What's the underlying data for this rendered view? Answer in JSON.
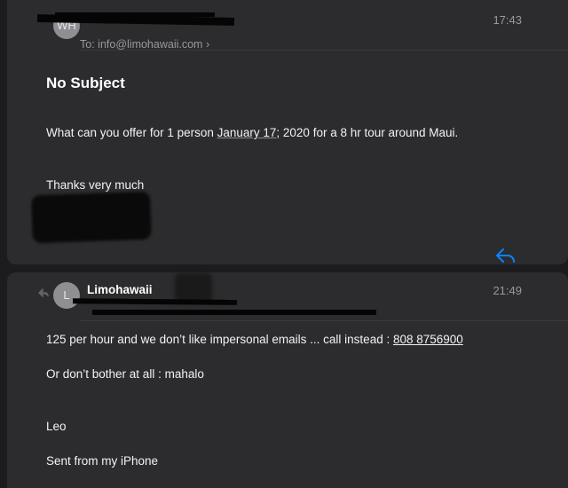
{
  "message1": {
    "avatar_initials": "WH",
    "to_label": "To:",
    "to_address": "info@limohawaii.com",
    "to_chevron": "›",
    "time": "17:43",
    "subject": "No Subject",
    "body_pre": "What can you offer for 1 person ",
    "body_date": "January 17",
    "body_post": "; 2020  for a 8 hr tour around Maui.",
    "thanks": "Thanks very much",
    "reply_icon": "reply-arrow-icon"
  },
  "message2": {
    "reply_indicator_icon": "reply-indicator-icon",
    "avatar_initials": "L",
    "sender": "Limohawaii",
    "time": "21:49",
    "line1_text": "125 per hour and we don’t like impersonal emails ... call instead : ",
    "line1_phone": "808 8756900",
    "line2": "Or don’t bother at all : mahalo",
    "line3": "Leo",
    "line4": "Sent from my iPhone"
  },
  "colors": {
    "background": "#1c1c1e",
    "card": "#2c2c2e",
    "accent": "#0a84ff",
    "secondary_text": "#98989d"
  }
}
